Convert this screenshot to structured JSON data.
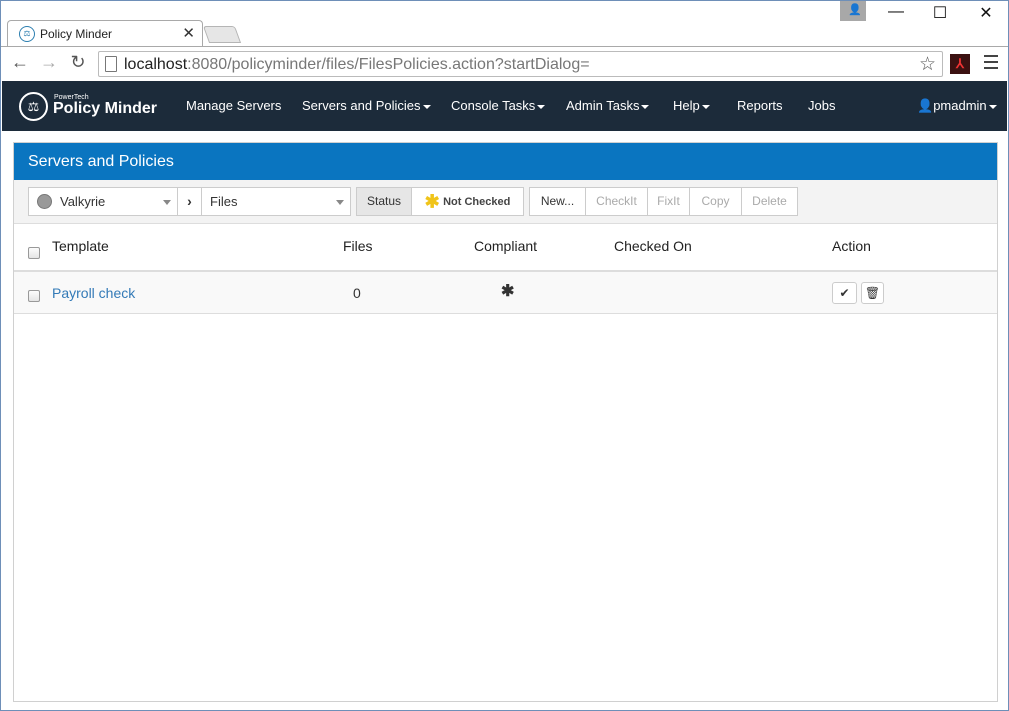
{
  "browser": {
    "tab_title": "Policy Minder",
    "tab_close": "✕",
    "url_host": "localhost",
    "url_rest": ":8080/policyminder/files/FilesPolicies.action?startDialog=",
    "window_controls": {
      "minimize": "—",
      "maximize": "☐",
      "close": "✕"
    },
    "back": "←",
    "forward": "→",
    "reload": "↻",
    "bookmark": "☆"
  },
  "app": {
    "logo_small": "PowerTech",
    "logo_big": "Policy Minder",
    "nav": [
      {
        "label": "Manage Servers",
        "dropdown": false
      },
      {
        "label": "Servers and Policies",
        "dropdown": true
      },
      {
        "label": "Console Tasks",
        "dropdown": true
      },
      {
        "label": "Admin Tasks",
        "dropdown": true
      },
      {
        "label": "Help",
        "dropdown": true
      },
      {
        "label": "Reports",
        "dropdown": false
      },
      {
        "label": "Jobs",
        "dropdown": false
      }
    ],
    "user": "pmadmin"
  },
  "panel": {
    "title": "Servers and Policies",
    "server_select": "Valkyrie",
    "category_select": "Files",
    "status_label": "Status",
    "status_value": "Not Checked",
    "status_icon_color": "#f0c419",
    "buttons": {
      "new": "New...",
      "checkit": "CheckIt",
      "fixit": "FixIt",
      "copy": "Copy",
      "delete": "Delete"
    }
  },
  "table": {
    "headers": {
      "template": "Template",
      "files": "Files",
      "compliant": "Compliant",
      "checked_on": "Checked On",
      "action": "Action"
    },
    "rows": [
      {
        "template": "Payroll check",
        "files": "0",
        "compliant": "not-checked",
        "checked_on": ""
      }
    ]
  },
  "colors": {
    "accent": "#0a75c0",
    "navbar": "#1c2b3a",
    "link": "#337ab7"
  }
}
